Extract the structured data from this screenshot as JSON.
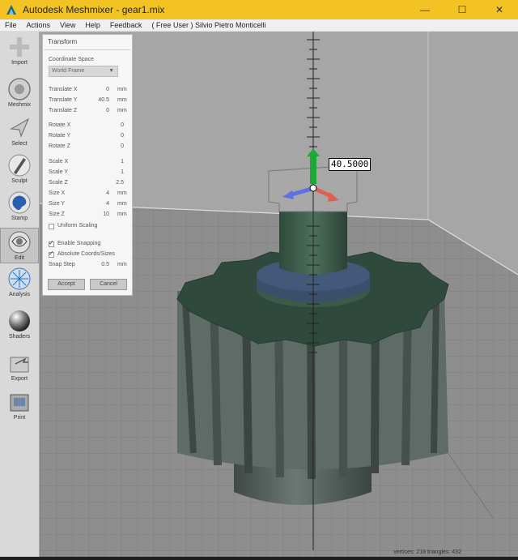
{
  "window": {
    "title": "Autodesk Meshmixer - gear1.mix",
    "minimize": "—",
    "maximize": "☐",
    "close": "✕"
  },
  "menu": {
    "items": [
      "File",
      "Actions",
      "View",
      "Help",
      "Feedback"
    ],
    "user": "( Free User ) Silvio Pietro Monticelli"
  },
  "toolbar": {
    "tools": [
      {
        "label": "Import",
        "icon": "plus-icon"
      },
      {
        "label": "Meshmix",
        "icon": "meshmix-icon"
      },
      {
        "label": "Select",
        "icon": "select-arrow-icon"
      },
      {
        "label": "Sculpt",
        "icon": "sculpt-brush-icon"
      },
      {
        "label": "Stamp",
        "icon": "stamp-icon"
      },
      {
        "label": "Edit",
        "icon": "edit-icon"
      },
      {
        "label": "Analysis",
        "icon": "analysis-icon"
      },
      {
        "label": "Shaders",
        "icon": "shaders-sphere-icon"
      },
      {
        "label": "Export",
        "icon": "export-icon"
      },
      {
        "label": "Print",
        "icon": "print-icon"
      }
    ],
    "active": "Edit"
  },
  "transform": {
    "title": "Transform",
    "coord_space_label": "Coordinate Space",
    "coord_space_value": "World Frame",
    "fields": [
      {
        "label": "Translate X",
        "value": "0",
        "unit": "mm"
      },
      {
        "label": "Translate Y",
        "value": "40.5",
        "unit": "mm"
      },
      {
        "label": "Translate Z",
        "value": "0",
        "unit": "mm"
      },
      {
        "label": "Rotate X",
        "value": "0",
        "unit": ""
      },
      {
        "label": "Rotate Y",
        "value": "0",
        "unit": ""
      },
      {
        "label": "Rotate Z",
        "value": "0",
        "unit": ""
      },
      {
        "label": "Scale X",
        "value": "1",
        "unit": ""
      },
      {
        "label": "Scale Y",
        "value": "1",
        "unit": ""
      },
      {
        "label": "Scale Z",
        "value": "2.5",
        "unit": ""
      },
      {
        "label": "Size X",
        "value": "4",
        "unit": "mm"
      },
      {
        "label": "Size Y",
        "value": "4",
        "unit": "mm"
      },
      {
        "label": "Size Z",
        "value": "10",
        "unit": "mm"
      }
    ],
    "uniform_scaling": {
      "label": "Uniform Scaling",
      "checked": false
    },
    "enable_snapping": {
      "label": "Enable Snapping",
      "checked": true
    },
    "absolute_coords": {
      "label": "Absolute Coords/Sizes",
      "checked": true
    },
    "snap_step_label": "Snap Step",
    "snap_step_value": "0.5",
    "snap_step_unit": "mm",
    "accept_label": "Accept",
    "cancel_label": "Cancel"
  },
  "viewport": {
    "readout": "40.5000",
    "status": "vertices: 218 triangles: 432"
  },
  "colors": {
    "titlebar": "#f2c322",
    "gear": "#5a6a62",
    "gear_top": "#2f4a3c",
    "axis_y": "#1ea83a",
    "axis_x": "#e06050",
    "axis_z": "#6070e0"
  }
}
